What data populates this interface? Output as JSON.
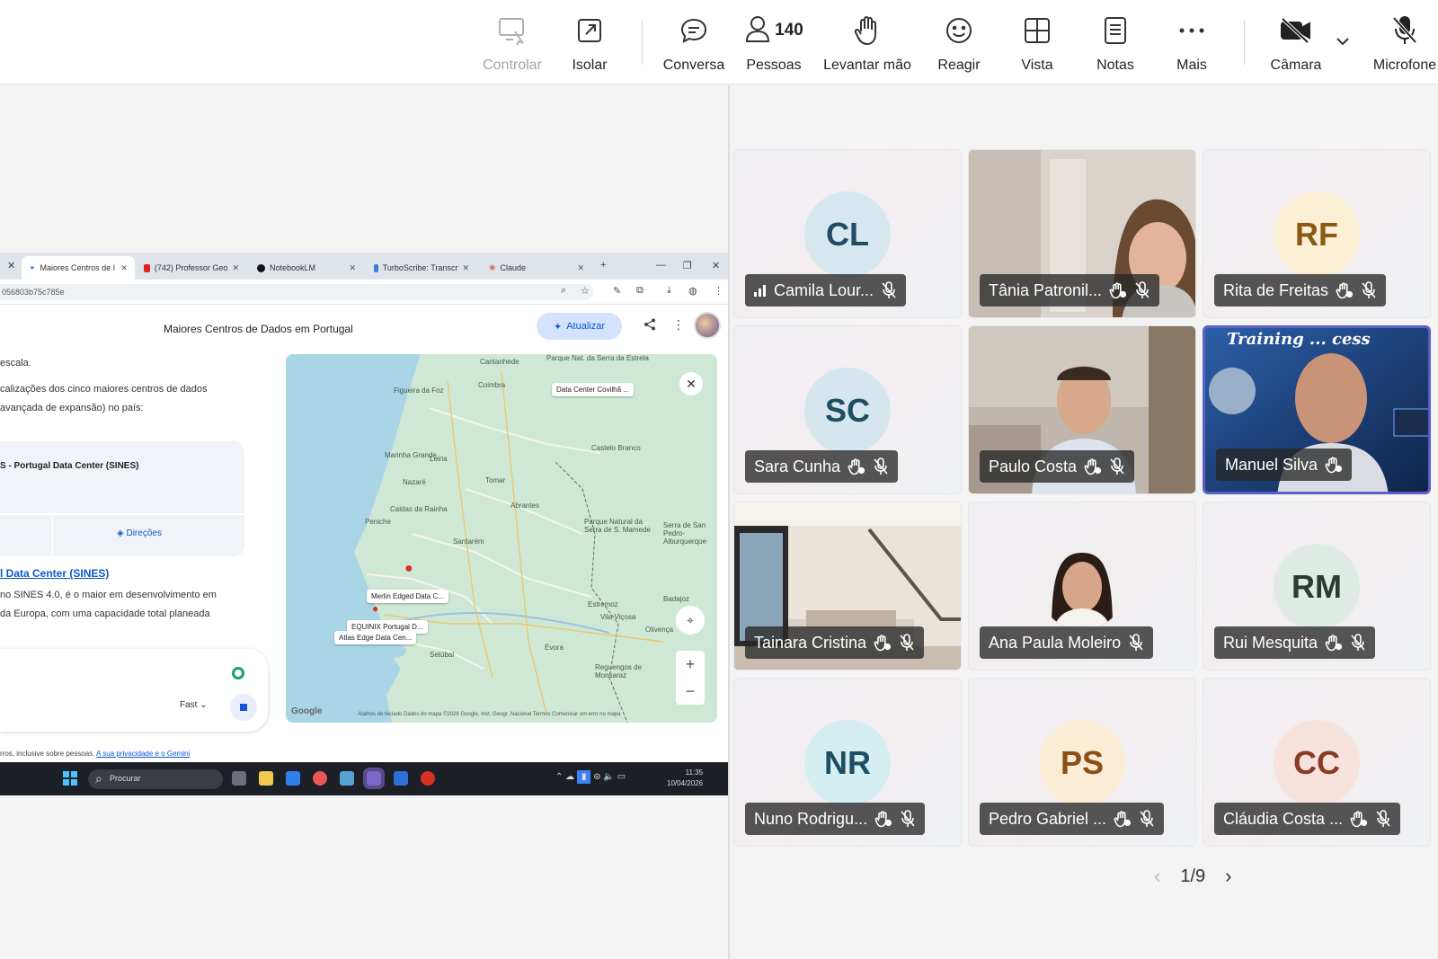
{
  "toolbar": {
    "control_label": "Controlar",
    "isolate_label": "Isolar",
    "chat_label": "Conversa",
    "people_label": "Pessoas",
    "people_count": "140",
    "raise_hand_label": "Levantar mão",
    "react_label": "Reagir",
    "view_label": "Vista",
    "notes_label": "Notas",
    "more_label": "Mais",
    "camera_label": "Câmara",
    "mic_label": "Microfone"
  },
  "shared_screen": {
    "tabs": [
      {
        "label": "Maiores Centros de I"
      },
      {
        "label": "(742) Professor Geo"
      },
      {
        "label": "NotebookLM"
      },
      {
        "label": "TurboScribe: Transcr"
      },
      {
        "label": "Claude"
      }
    ],
    "url": "056803b75c785e",
    "page_title": "Maiores Centros de Dados em Portugal",
    "update_button": "Atualizar",
    "text_lines": [
      "escala.",
      "calizações dos cinco maiores centros de dados",
      "avançada de expansão) no país:"
    ],
    "card_title": "S - Portugal Data Center (SINES)",
    "directions_label": "Direções",
    "link_text": "l Data Center (SINES)",
    "body_lines": [
      "no SINES 4.0, é o maior em desenvolvimento em",
      "da Europa, com uma capacidade total planeada"
    ],
    "model_label": "Fast",
    "footer_text": "rros, inclusive sobre pessoas. ",
    "footer_link": "A sua privacidade e o Gemini",
    "map": {
      "labels": [
        "Data Center Covilhã ...",
        "Merlin Edged Data C...",
        "EQUINIX Portugal D...",
        "Atlas Edge Data Cen..."
      ],
      "cities": [
        "Coimbra",
        "Figueira da Foz",
        "Leiria",
        "Marinha Grande",
        "Castelo Branco",
        "Tomar",
        "Nazaré",
        "Abrantes",
        "Caldas da Rainha",
        "Peniche",
        "Santarém",
        "Évora",
        "Setúbal",
        "Badajoz",
        "Estremoz",
        "Vila Viçosa",
        "Olivença",
        "Reguengos de Monsaraz",
        "Parque Natural da Serra de S. Mamede",
        "Serra de San Pedro-Alburquerque",
        "Cantanhede",
        "Parque Nat. da Serra da Estrela"
      ],
      "attribution": "Atalhos de teclado   Dados do mapa ©2026 Google, Inst. Geogr. Nacional   Termos   Comunicar um erro no mapa"
    },
    "taskbar": {
      "search_placeholder": "Procurar",
      "time": "11:35",
      "date": "10/04/2026"
    }
  },
  "participants": [
    {
      "name": "Camila Lour...",
      "initials": "CL",
      "color": "#d7e7ef",
      "text_color": "#1e4e63",
      "signal": true
    },
    {
      "name": "Tânia Patronil...",
      "photo": true
    },
    {
      "name": "Rita de Freitas",
      "initials": "RF",
      "color": "#fbefd6",
      "text_color": "#8a5a14"
    },
    {
      "name": "Sara Cunha",
      "initials": "SC",
      "color": "#d6e6ee",
      "text_color": "#1e4e63"
    },
    {
      "name": "Paulo Costa",
      "photo": true
    },
    {
      "name": "Manuel Silva",
      "photo": true,
      "background_text": "Training ... cess"
    },
    {
      "name": "Tainara Cristina",
      "photo": true
    },
    {
      "name": "Ana Paula Moleiro",
      "photo": true
    },
    {
      "name": "Rui Mesquita",
      "initials": "RM",
      "color": "#e0ebe5",
      "text_color": "#2b3b33"
    },
    {
      "name": "Nuno Rodrigu...",
      "initials": "NR",
      "color": "#d5eef2",
      "text_color": "#1e4e63"
    },
    {
      "name": "Pedro Gabriel ...",
      "initials": "PS",
      "color": "#fbecd6",
      "text_color": "#8a4f14"
    },
    {
      "name": "Cláudia Costa ...",
      "initials": "CC",
      "color": "#f7e2dc",
      "text_color": "#8a3b24"
    }
  ],
  "pager": {
    "label": "1/9"
  },
  "colors": {
    "accent": "#5b5fc7",
    "link": "#0b57d0"
  }
}
